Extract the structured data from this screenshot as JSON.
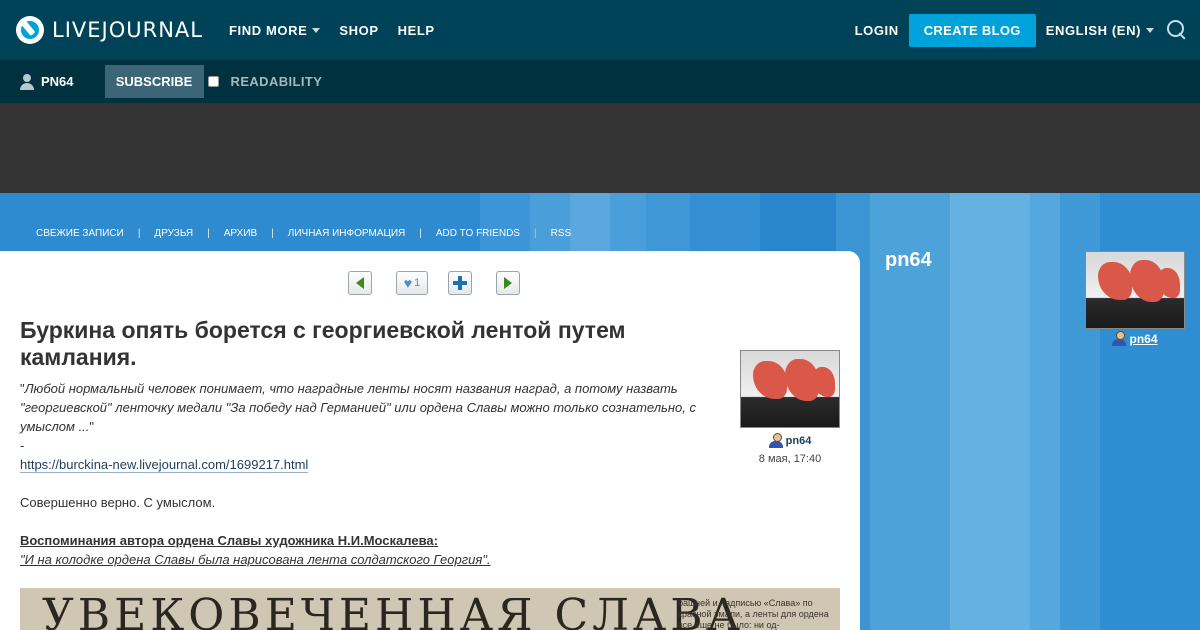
{
  "header": {
    "logo_text": "LIVEJOURNAL",
    "nav": [
      {
        "label": "FIND MORE",
        "has_dropdown": true
      },
      {
        "label": "SHOP",
        "has_dropdown": false
      },
      {
        "label": "HELP",
        "has_dropdown": false
      }
    ],
    "login_label": "LOGIN",
    "create_blog_label": "CREATE BLOG",
    "language_label": "ENGLISH (EN)",
    "accent_color": "#00a3d9",
    "background_color": "#004359"
  },
  "subbar": {
    "username": "PN64",
    "subscribe_label": "SUBSCRIBE",
    "readability_label": "READABILITY",
    "readability_checked": false
  },
  "journal_nav": {
    "items": [
      "СВЕЖИЕ ЗАПИСИ",
      "ДРУЗЬЯ",
      "АРХИВ",
      "ЛИЧНАЯ ИНФОРМАЦИЯ",
      "ADD TO FRIENDS",
      "RSS"
    ],
    "separator": "|"
  },
  "entry": {
    "like_count": "1",
    "title": "Буркина опять борется с георгиевской лентой путем камлания.",
    "quote_open": "\"",
    "quote_text": "Любой нормальный человек понимает, что наградные ленты носят названия наград, а потому назвать \"георгиевской\" ленточку медали \"За победу над Германией\" или ордена Славы можно только сознательно, с умыслом ...",
    "quote_close": "\"",
    "dash": "-",
    "source_link": "https://burckina-new.livejournal.com/1699217.html",
    "comment": "Совершенно верно. С умыслом.",
    "memoir_heading": "Воспоминания автора ордена Славы художника Н.И.Москалева:",
    "memoir_quote": "\"И на колодке ордена Славы была нарисована лента солдатского Георгия\".",
    "poster": "pn64",
    "date": "8 мая, 17:40",
    "scan_headline": "УВЕКОВЕЧЕННАЯ СЛАВА",
    "scan_text": "башней и надписью «Слава» по красной эмали, а ленты для ордена все еще не было: ни од-"
  },
  "sidebar": {
    "title": "pn64",
    "username": "pn64"
  }
}
